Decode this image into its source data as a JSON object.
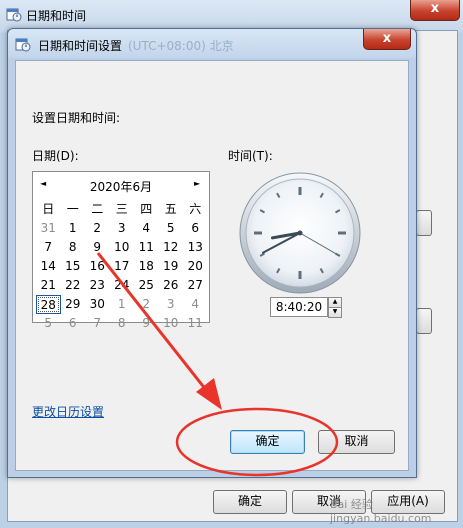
{
  "outer": {
    "title": "日期和时间",
    "close_glyph": "x",
    "buttons": {
      "ok": "确定",
      "cancel": "取消",
      "apply": "应用(A)"
    }
  },
  "dialog": {
    "title": "日期和时间设置",
    "ghost_text": "(UTC+08:00) 北京",
    "close_glyph": "x",
    "heading": "设置日期和时间:",
    "date_label": "日期(D):",
    "time_label": "时间(T):",
    "calendar": {
      "month_title": "2020年6月",
      "prev_glyph": "◄",
      "next_glyph": "►",
      "weekdays": [
        "日",
        "一",
        "二",
        "三",
        "四",
        "五",
        "六"
      ],
      "weeks": [
        [
          {
            "d": "31",
            "g": true
          },
          {
            "d": "1"
          },
          {
            "d": "2"
          },
          {
            "d": "3"
          },
          {
            "d": "4"
          },
          {
            "d": "5"
          },
          {
            "d": "6"
          }
        ],
        [
          {
            "d": "7"
          },
          {
            "d": "8"
          },
          {
            "d": "9"
          },
          {
            "d": "10"
          },
          {
            "d": "11"
          },
          {
            "d": "12"
          },
          {
            "d": "13"
          }
        ],
        [
          {
            "d": "14"
          },
          {
            "d": "15"
          },
          {
            "d": "16"
          },
          {
            "d": "17"
          },
          {
            "d": "18"
          },
          {
            "d": "19"
          },
          {
            "d": "20"
          }
        ],
        [
          {
            "d": "21"
          },
          {
            "d": "22"
          },
          {
            "d": "23"
          },
          {
            "d": "24"
          },
          {
            "d": "25"
          },
          {
            "d": "26"
          },
          {
            "d": "27"
          }
        ],
        [
          {
            "d": "28",
            "sel": true
          },
          {
            "d": "29"
          },
          {
            "d": "30"
          },
          {
            "d": "1",
            "g": true
          },
          {
            "d": "2",
            "g": true
          },
          {
            "d": "3",
            "g": true
          },
          {
            "d": "4",
            "g": true
          }
        ],
        [
          {
            "d": "5",
            "g": true
          },
          {
            "d": "6",
            "g": true
          },
          {
            "d": "7",
            "g": true
          },
          {
            "d": "8",
            "g": true
          },
          {
            "d": "9",
            "g": true
          },
          {
            "d": "10",
            "g": true
          },
          {
            "d": "11",
            "g": true
          }
        ]
      ]
    },
    "clock": {
      "hours": 8,
      "minutes": 40,
      "seconds": 20
    },
    "time_value": "8:40:20",
    "change_calendar_link": "更改日历设置",
    "ok_label": "确定",
    "cancel_label": "取消"
  },
  "watermark": "Bai 经验 jingyan.baidu.com",
  "colors": {
    "annotation": "#e8342a",
    "link": "#0d4fa3",
    "primary_border": "#3c7fb1"
  }
}
